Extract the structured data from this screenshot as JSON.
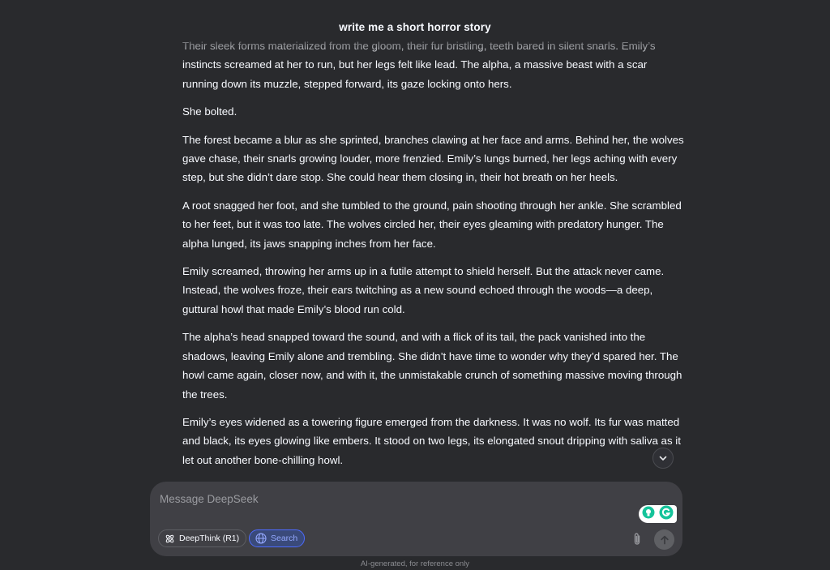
{
  "header": {
    "title": "write me a short horror story"
  },
  "story": {
    "paragraphs": [
      "Their sleek forms materialized from the gloom, their fur bristling, teeth bared in silent snarls. Emily’s instincts screamed at her to run, but her legs felt like lead. The alpha, a massive beast with a scar running down its muzzle, stepped forward, its gaze locking onto hers.",
      "She bolted.",
      "The forest became a blur as she sprinted, branches clawing at her face and arms. Behind her, the wolves gave chase, their snarls growing louder, more frenzied. Emily’s lungs burned, her legs aching with every step, but she didn’t dare stop. She could hear them closing in, their hot breath on her heels.",
      "A root snagged her foot, and she tumbled to the ground, pain shooting through her ankle. She scrambled to her feet, but it was too late. The wolves circled her, their eyes gleaming with predatory hunger. The alpha lunged, its jaws snapping inches from her face.",
      "Emily screamed, throwing her arms up in a futile attempt to shield herself. But the attack never came. Instead, the wolves froze, their ears twitching as a new sound echoed through the woods—a deep, guttural howl that made Emily’s blood run cold.",
      "The alpha’s head snapped toward the sound, and with a flick of its tail, the pack vanished into the shadows, leaving Emily alone and trembling. She didn’t have time to wonder why they’d spared her. The howl came again, closer now, and with it, the unmistakable crunch of something massive moving through the trees.",
      "Emily’s eyes widened as a towering figure emerged from the darkness. It was no wolf. Its fur was matted and black, its eyes glowing like embers. It stood on two legs, its elongated snout dripping with saliva as it let out another bone-chilling howl."
    ]
  },
  "composer": {
    "placeholder": "Message DeepSeek",
    "deepthink_label": "DeepThink (R1)",
    "search_label": "Search"
  },
  "footer": {
    "disclaimer": "AI-generated, for reference only"
  },
  "icons": {
    "scroll_down": "chevron-down-icon",
    "deepthink": "atom-icon",
    "search": "globe-icon",
    "attach": "paperclip-icon",
    "send": "arrow-up-icon",
    "grammarly": "grammarly-icon",
    "assistant": "bulb-icon"
  },
  "colors": {
    "background": "#292a2d",
    "composer": "#404045",
    "accent": "#4d6bfe",
    "grammarly": "#15c39a"
  }
}
